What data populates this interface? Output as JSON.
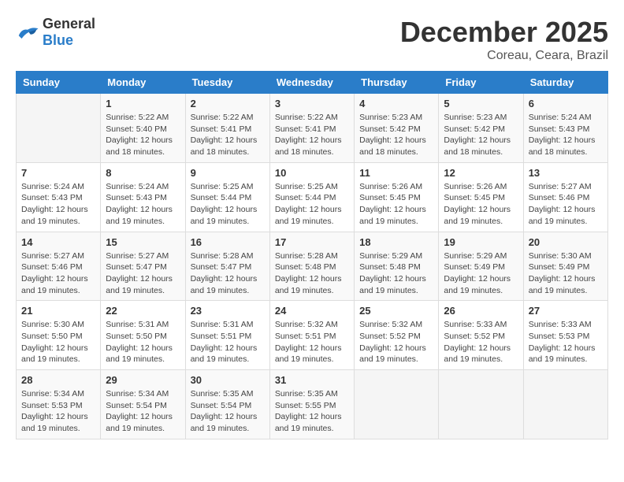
{
  "header": {
    "logo_general": "General",
    "logo_blue": "Blue",
    "title": "December 2025",
    "location": "Coreau, Ceara, Brazil"
  },
  "calendar": {
    "days_of_week": [
      "Sunday",
      "Monday",
      "Tuesday",
      "Wednesday",
      "Thursday",
      "Friday",
      "Saturday"
    ],
    "weeks": [
      [
        {
          "day": "",
          "info": ""
        },
        {
          "day": "1",
          "info": "Sunrise: 5:22 AM\nSunset: 5:40 PM\nDaylight: 12 hours\nand 18 minutes."
        },
        {
          "day": "2",
          "info": "Sunrise: 5:22 AM\nSunset: 5:41 PM\nDaylight: 12 hours\nand 18 minutes."
        },
        {
          "day": "3",
          "info": "Sunrise: 5:22 AM\nSunset: 5:41 PM\nDaylight: 12 hours\nand 18 minutes."
        },
        {
          "day": "4",
          "info": "Sunrise: 5:23 AM\nSunset: 5:42 PM\nDaylight: 12 hours\nand 18 minutes."
        },
        {
          "day": "5",
          "info": "Sunrise: 5:23 AM\nSunset: 5:42 PM\nDaylight: 12 hours\nand 18 minutes."
        },
        {
          "day": "6",
          "info": "Sunrise: 5:24 AM\nSunset: 5:43 PM\nDaylight: 12 hours\nand 18 minutes."
        }
      ],
      [
        {
          "day": "7",
          "info": "Sunrise: 5:24 AM\nSunset: 5:43 PM\nDaylight: 12 hours\nand 19 minutes."
        },
        {
          "day": "8",
          "info": "Sunrise: 5:24 AM\nSunset: 5:43 PM\nDaylight: 12 hours\nand 19 minutes."
        },
        {
          "day": "9",
          "info": "Sunrise: 5:25 AM\nSunset: 5:44 PM\nDaylight: 12 hours\nand 19 minutes."
        },
        {
          "day": "10",
          "info": "Sunrise: 5:25 AM\nSunset: 5:44 PM\nDaylight: 12 hours\nand 19 minutes."
        },
        {
          "day": "11",
          "info": "Sunrise: 5:26 AM\nSunset: 5:45 PM\nDaylight: 12 hours\nand 19 minutes."
        },
        {
          "day": "12",
          "info": "Sunrise: 5:26 AM\nSunset: 5:45 PM\nDaylight: 12 hours\nand 19 minutes."
        },
        {
          "day": "13",
          "info": "Sunrise: 5:27 AM\nSunset: 5:46 PM\nDaylight: 12 hours\nand 19 minutes."
        }
      ],
      [
        {
          "day": "14",
          "info": "Sunrise: 5:27 AM\nSunset: 5:46 PM\nDaylight: 12 hours\nand 19 minutes."
        },
        {
          "day": "15",
          "info": "Sunrise: 5:27 AM\nSunset: 5:47 PM\nDaylight: 12 hours\nand 19 minutes."
        },
        {
          "day": "16",
          "info": "Sunrise: 5:28 AM\nSunset: 5:47 PM\nDaylight: 12 hours\nand 19 minutes."
        },
        {
          "day": "17",
          "info": "Sunrise: 5:28 AM\nSunset: 5:48 PM\nDaylight: 12 hours\nand 19 minutes."
        },
        {
          "day": "18",
          "info": "Sunrise: 5:29 AM\nSunset: 5:48 PM\nDaylight: 12 hours\nand 19 minutes."
        },
        {
          "day": "19",
          "info": "Sunrise: 5:29 AM\nSunset: 5:49 PM\nDaylight: 12 hours\nand 19 minutes."
        },
        {
          "day": "20",
          "info": "Sunrise: 5:30 AM\nSunset: 5:49 PM\nDaylight: 12 hours\nand 19 minutes."
        }
      ],
      [
        {
          "day": "21",
          "info": "Sunrise: 5:30 AM\nSunset: 5:50 PM\nDaylight: 12 hours\nand 19 minutes."
        },
        {
          "day": "22",
          "info": "Sunrise: 5:31 AM\nSunset: 5:50 PM\nDaylight: 12 hours\nand 19 minutes."
        },
        {
          "day": "23",
          "info": "Sunrise: 5:31 AM\nSunset: 5:51 PM\nDaylight: 12 hours\nand 19 minutes."
        },
        {
          "day": "24",
          "info": "Sunrise: 5:32 AM\nSunset: 5:51 PM\nDaylight: 12 hours\nand 19 minutes."
        },
        {
          "day": "25",
          "info": "Sunrise: 5:32 AM\nSunset: 5:52 PM\nDaylight: 12 hours\nand 19 minutes."
        },
        {
          "day": "26",
          "info": "Sunrise: 5:33 AM\nSunset: 5:52 PM\nDaylight: 12 hours\nand 19 minutes."
        },
        {
          "day": "27",
          "info": "Sunrise: 5:33 AM\nSunset: 5:53 PM\nDaylight: 12 hours\nand 19 minutes."
        }
      ],
      [
        {
          "day": "28",
          "info": "Sunrise: 5:34 AM\nSunset: 5:53 PM\nDaylight: 12 hours\nand 19 minutes."
        },
        {
          "day": "29",
          "info": "Sunrise: 5:34 AM\nSunset: 5:54 PM\nDaylight: 12 hours\nand 19 minutes."
        },
        {
          "day": "30",
          "info": "Sunrise: 5:35 AM\nSunset: 5:54 PM\nDaylight: 12 hours\nand 19 minutes."
        },
        {
          "day": "31",
          "info": "Sunrise: 5:35 AM\nSunset: 5:55 PM\nDaylight: 12 hours\nand 19 minutes."
        },
        {
          "day": "",
          "info": ""
        },
        {
          "day": "",
          "info": ""
        },
        {
          "day": "",
          "info": ""
        }
      ]
    ]
  }
}
